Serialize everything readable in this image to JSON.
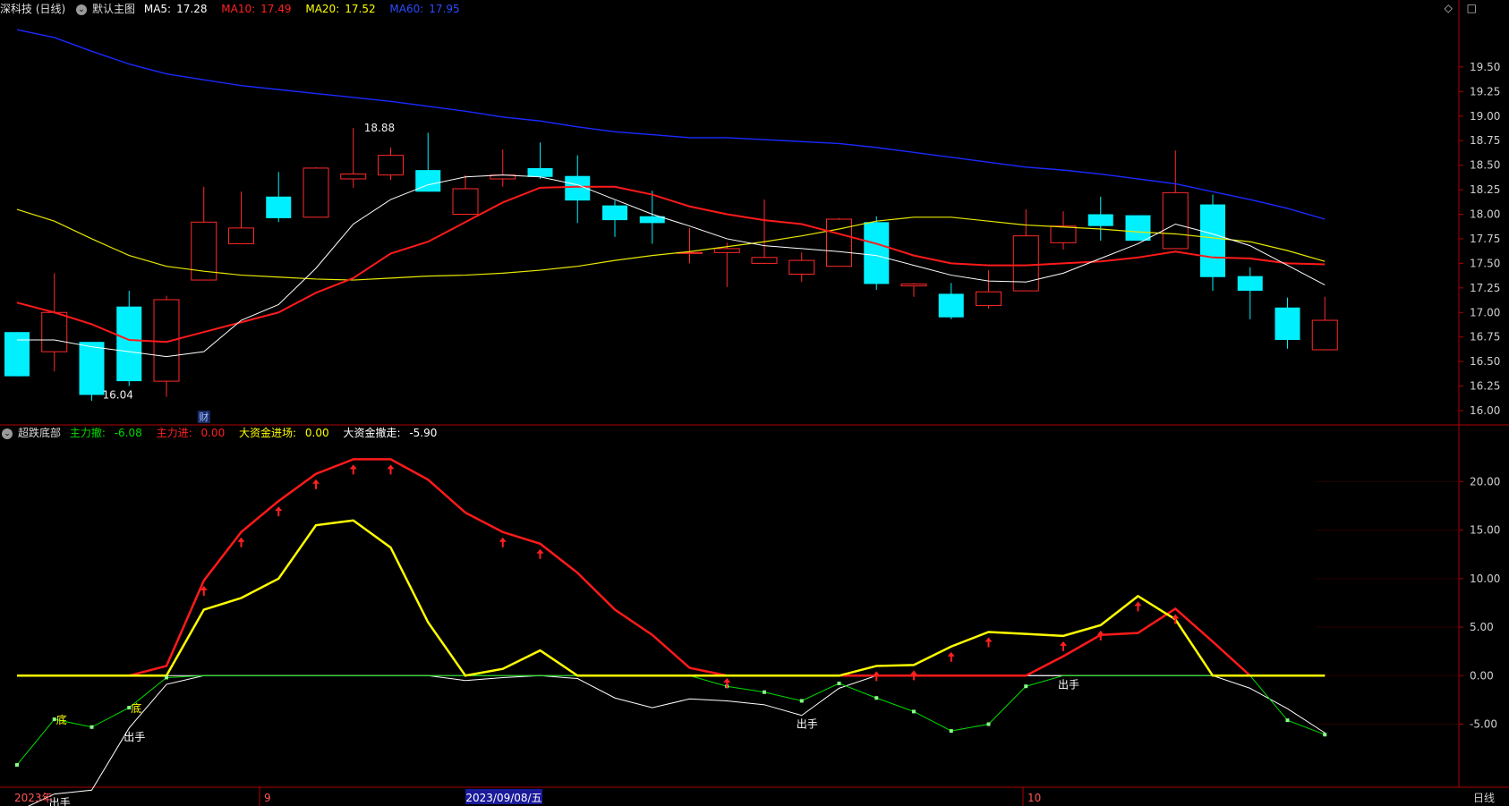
{
  "main": {
    "stock_title": "深科技 (日线)",
    "template": "默认主图",
    "ma": [
      {
        "label": "MA5:",
        "value": "17.28",
        "color": "#ffffff"
      },
      {
        "label": "MA10:",
        "value": "17.49",
        "color": "#ff2020"
      },
      {
        "label": "MA20:",
        "value": "17.52",
        "color": "#ffff00"
      },
      {
        "label": "MA60:",
        "value": "17.95",
        "color": "#2244ff"
      }
    ],
    "toolbar": {
      "diamond": "◇",
      "square": "□"
    }
  },
  "sub": {
    "indicator": "超跌底部",
    "items": [
      {
        "label": "主力撤:",
        "value": "-6.08",
        "color": "#00dd00"
      },
      {
        "label": "主力进:",
        "value": "0.00",
        "color": "#ff2020"
      },
      {
        "label": "大资金进场:",
        "value": "0.00",
        "color": "#ffff00"
      },
      {
        "label": "大资金撤走:",
        "value": "-5.90",
        "color": "#ffffff"
      }
    ]
  },
  "colors": {
    "up": "#ff2a2a",
    "down": "#00f0ff",
    "axis": "#b00000",
    "ma5": "#ffffff",
    "ma10": "#ff1a1a",
    "ma20": "#e8e800",
    "ma60": "#1a2aff"
  },
  "chart_data": [
    {
      "type": "candlestick",
      "title": "深科技 (日线)",
      "ylim": [
        15.9,
        20.0
      ],
      "y_ticks": [
        16.0,
        16.25,
        16.5,
        16.75,
        17.0,
        17.25,
        17.5,
        17.75,
        18.0,
        18.25,
        18.5,
        18.75,
        19.0,
        19.25,
        19.5
      ],
      "x_labels": [
        "2023年",
        "9",
        "2023/09/08/五",
        "10"
      ],
      "annotations": [
        {
          "text": "18.88",
          "index": 9,
          "price": 18.88
        },
        {
          "text": "16.04",
          "index": 2,
          "price": 16.16
        },
        {
          "text": "财",
          "index": 5
        }
      ],
      "candles": [
        {
          "o": 16.8,
          "h": 16.8,
          "l": 16.35,
          "c": 16.35
        },
        {
          "o": 16.6,
          "h": 17.4,
          "l": 16.4,
          "c": 17.0
        },
        {
          "o": 16.7,
          "h": 16.7,
          "l": 16.1,
          "c": 16.16
        },
        {
          "o": 17.06,
          "h": 17.22,
          "l": 16.25,
          "c": 16.3
        },
        {
          "o": 16.3,
          "h": 17.17,
          "l": 16.14,
          "c": 17.13
        },
        {
          "o": 17.33,
          "h": 18.28,
          "l": 17.33,
          "c": 17.92
        },
        {
          "o": 17.7,
          "h": 18.23,
          "l": 17.7,
          "c": 17.86
        },
        {
          "o": 18.18,
          "h": 18.43,
          "l": 17.92,
          "c": 17.96
        },
        {
          "o": 17.97,
          "h": 18.48,
          "l": 17.97,
          "c": 18.47
        },
        {
          "o": 18.36,
          "h": 18.88,
          "l": 18.27,
          "c": 18.41
        },
        {
          "o": 18.4,
          "h": 18.68,
          "l": 18.35,
          "c": 18.6
        },
        {
          "o": 18.45,
          "h": 18.83,
          "l": 18.23,
          "c": 18.23
        },
        {
          "o": 18.0,
          "h": 18.4,
          "l": 18.0,
          "c": 18.26
        },
        {
          "o": 18.36,
          "h": 18.66,
          "l": 18.28,
          "c": 18.4
        },
        {
          "o": 18.47,
          "h": 18.73,
          "l": 18.36,
          "c": 18.38
        },
        {
          "o": 18.39,
          "h": 18.6,
          "l": 17.91,
          "c": 18.14
        },
        {
          "o": 18.09,
          "h": 18.14,
          "l": 17.77,
          "c": 17.94
        },
        {
          "o": 17.98,
          "h": 18.24,
          "l": 17.7,
          "c": 17.91
        },
        {
          "o": 17.61,
          "h": 17.86,
          "l": 17.5,
          "c": 17.61
        },
        {
          "o": 17.61,
          "h": 17.71,
          "l": 17.26,
          "c": 17.65
        },
        {
          "o": 17.5,
          "h": 18.15,
          "l": 17.5,
          "c": 17.56
        },
        {
          "o": 17.39,
          "h": 17.61,
          "l": 17.31,
          "c": 17.53
        },
        {
          "o": 17.47,
          "h": 17.96,
          "l": 17.47,
          "c": 17.95
        },
        {
          "o": 17.92,
          "h": 17.98,
          "l": 17.23,
          "c": 17.29
        },
        {
          "o": 17.27,
          "h": 17.3,
          "l": 17.16,
          "c": 17.29
        },
        {
          "o": 17.19,
          "h": 17.3,
          "l": 16.93,
          "c": 16.95
        },
        {
          "o": 17.07,
          "h": 17.43,
          "l": 17.04,
          "c": 17.21
        },
        {
          "o": 17.22,
          "h": 18.05,
          "l": 17.22,
          "c": 17.78
        },
        {
          "o": 17.71,
          "h": 18.03,
          "l": 17.64,
          "c": 17.88
        },
        {
          "o": 18.0,
          "h": 18.18,
          "l": 17.73,
          "c": 17.88
        },
        {
          "o": 17.99,
          "h": 17.99,
          "l": 17.73,
          "c": 17.73
        },
        {
          "o": 17.65,
          "h": 18.65,
          "l": 17.65,
          "c": 18.22
        },
        {
          "o": 18.1,
          "h": 18.2,
          "l": 17.22,
          "c": 17.36
        },
        {
          "o": 17.37,
          "h": 17.46,
          "l": 16.93,
          "c": 17.22
        },
        {
          "o": 17.05,
          "h": 17.15,
          "l": 16.63,
          "c": 16.72
        },
        {
          "o": 16.62,
          "h": 17.16,
          "l": 16.62,
          "c": 16.92
        }
      ],
      "ma5": [
        16.72,
        16.72,
        16.65,
        16.6,
        16.55,
        16.6,
        16.92,
        17.08,
        17.45,
        17.9,
        18.15,
        18.3,
        18.38,
        18.4,
        18.38,
        18.3,
        18.15,
        18.0,
        17.88,
        17.75,
        17.68,
        17.65,
        17.62,
        17.58,
        17.48,
        17.38,
        17.32,
        17.31,
        17.4,
        17.55,
        17.7,
        17.9,
        17.8,
        17.68,
        17.48,
        17.28
      ],
      "ma10": [
        17.1,
        17.0,
        16.88,
        16.72,
        16.7,
        16.8,
        16.9,
        17.0,
        17.2,
        17.35,
        17.6,
        17.72,
        17.92,
        18.12,
        18.27,
        18.28,
        18.28,
        18.2,
        18.08,
        18.0,
        17.94,
        17.9,
        17.8,
        17.7,
        17.58,
        17.5,
        17.48,
        17.48,
        17.5,
        17.52,
        17.56,
        17.62,
        17.56,
        17.55,
        17.5,
        17.49
      ],
      "ma20": [
        18.05,
        17.93,
        17.75,
        17.58,
        17.47,
        17.42,
        17.38,
        17.36,
        17.34,
        17.33,
        17.35,
        17.37,
        17.38,
        17.4,
        17.43,
        17.47,
        17.53,
        17.58,
        17.62,
        17.67,
        17.72,
        17.78,
        17.85,
        17.93,
        17.97,
        17.97,
        17.93,
        17.89,
        17.87,
        17.85,
        17.82,
        17.8,
        17.76,
        17.72,
        17.63,
        17.52
      ],
      "ma60_start": 19.88,
      "ma60": [
        19.88,
        19.8,
        19.66,
        19.53,
        19.43,
        19.37,
        19.31,
        19.27,
        19.23,
        19.19,
        19.15,
        19.1,
        19.05,
        18.99,
        18.95,
        18.89,
        18.84,
        18.81,
        18.78,
        18.78,
        18.76,
        18.74,
        18.72,
        18.68,
        18.63,
        18.58,
        18.53,
        18.48,
        18.45,
        18.41,
        18.36,
        18.31,
        18.23,
        18.15,
        18.06,
        17.95
      ]
    },
    {
      "type": "line",
      "title": "超跌底部",
      "ylim": [
        -11.5,
        24.0
      ],
      "y_ticks": [
        -5.0,
        0.0,
        5.0,
        10.0,
        15.0,
        20.0
      ],
      "series": [
        {
          "name": "主力撤",
          "color": "#00dd00",
          "values": [
            -9.2,
            -4.5,
            -5.3,
            -3.3,
            -0.2,
            0,
            0,
            0,
            0,
            0,
            0,
            0,
            0,
            0,
            0,
            0,
            0,
            0,
            0,
            -1.1,
            -1.7,
            -2.6,
            -0.8,
            -2.3,
            -3.7,
            -5.7,
            -5.0,
            -1.1,
            0,
            0,
            0,
            0,
            0,
            0,
            -4.6,
            -6.08
          ]
        },
        {
          "name": "主力进",
          "color": "#ff1a1a",
          "values": [
            0,
            0,
            0,
            0,
            1.0,
            9.8,
            14.8,
            18.0,
            20.8,
            22.3,
            22.3,
            20.2,
            16.8,
            14.8,
            13.6,
            10.6,
            6.8,
            4.2,
            0.8,
            0,
            0,
            0,
            0,
            0,
            0,
            0,
            0,
            0,
            2.0,
            4.2,
            4.4,
            6.9,
            3.5,
            0,
            0,
            0
          ]
        },
        {
          "name": "大资金进场",
          "color": "#ffff00",
          "values": [
            0,
            0,
            0,
            0,
            0,
            6.8,
            8.0,
            10.0,
            15.5,
            16.0,
            13.2,
            5.5,
            0,
            0.7,
            2.6,
            0,
            0,
            0,
            0,
            0,
            0,
            0,
            0,
            1.0,
            1.1,
            3.0,
            4.5,
            4.3,
            4.1,
            5.2,
            8.2,
            5.8,
            0,
            0,
            0,
            0
          ]
        },
        {
          "name": "大资金撤走",
          "color": "#ffffff",
          "values": [
            -14.0,
            -12.2,
            -11.8,
            -5.4,
            -0.9,
            0,
            0,
            0,
            0,
            0,
            0,
            0,
            -0.5,
            -0.2,
            0,
            -0.3,
            -2.3,
            -3.3,
            -2.4,
            -2.6,
            -3.0,
            -4.1,
            -1.3,
            0,
            0,
            0,
            0,
            0,
            0,
            0,
            0,
            0,
            0,
            -1.3,
            -3.4,
            -5.9
          ]
        }
      ],
      "labels": [
        {
          "text": "底",
          "index": 1,
          "value": -4.5
        },
        {
          "text": "底",
          "index": 3,
          "value": -3.3
        },
        {
          "text": "出手",
          "index": 3,
          "value": -5.4
        },
        {
          "text": "出手",
          "index": 1,
          "value": -12.2
        },
        {
          "text": "出手",
          "index": 21,
          "value": -4.1
        },
        {
          "text": "出手",
          "index": 28,
          "value": 0
        }
      ],
      "arrows": [
        5,
        6,
        7,
        8,
        9,
        10,
        13,
        14,
        19,
        23,
        24,
        25,
        26,
        28,
        29,
        30,
        31
      ]
    }
  ],
  "status": {
    "period": "日线"
  }
}
